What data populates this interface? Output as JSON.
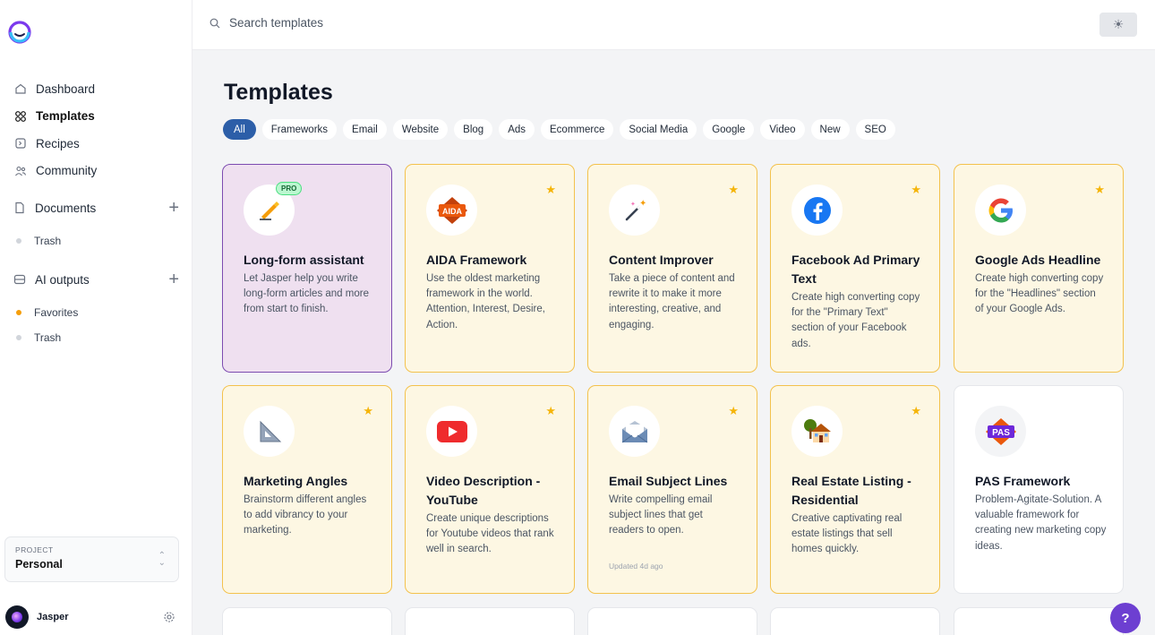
{
  "app": {
    "name": "Jasper"
  },
  "search": {
    "placeholder": "Search templates"
  },
  "sidebar": {
    "nav": [
      {
        "label": "Dashboard",
        "icon": "home-icon"
      },
      {
        "label": "Templates",
        "icon": "grid-icon",
        "active": true
      },
      {
        "label": "Recipes",
        "icon": "recipe-icon"
      },
      {
        "label": "Community",
        "icon": "community-icon"
      }
    ],
    "documents": {
      "label": "Documents",
      "trash": "Trash"
    },
    "ai_outputs": {
      "label": "AI outputs",
      "favorites": "Favorites",
      "trash": "Trash"
    },
    "project": {
      "label": "PROJECT",
      "value": "Personal"
    },
    "user": {
      "name": "Jasper"
    }
  },
  "main": {
    "title": "Templates",
    "chips": [
      "All",
      "Frameworks",
      "Email",
      "Website",
      "Blog",
      "Ads",
      "Ecommerce",
      "Social Media",
      "Google",
      "Video",
      "New",
      "SEO"
    ],
    "cards": [
      {
        "title": "Long-form assistant",
        "desc": "Let Jasper help you write long-form articles and more from start to finish.",
        "icon": "writing-hand-icon",
        "badge": "PRO",
        "style": "purple"
      },
      {
        "title": "AIDA Framework",
        "desc": "Use the oldest marketing framework in the world. Attention, Interest, Desire, Action.",
        "icon": "aida-icon",
        "icon_text": "AIDA",
        "star": true
      },
      {
        "title": "Content Improver",
        "desc": "Take a piece of content and rewrite it to make it more interesting, creative, and engaging.",
        "icon": "magic-wand-icon",
        "star": true
      },
      {
        "title": "Facebook Ad Primary Text",
        "desc": "Create high converting copy for the \"Primary Text\" section of your Facebook ads.",
        "icon": "facebook-icon",
        "star": true
      },
      {
        "title": "Google Ads Headline",
        "desc": "Create high converting copy for the \"Headlines\" section of your Google Ads.",
        "icon": "google-icon",
        "star": true
      },
      {
        "title": "Marketing Angles",
        "desc": "Brainstorm different angles to add vibrancy to your marketing.",
        "icon": "triangle-ruler-icon",
        "star": true
      },
      {
        "title": "Video Description - YouTube",
        "desc": "Create unique descriptions for Youtube videos that rank well in search.",
        "icon": "youtube-icon",
        "star": true
      },
      {
        "title": "Email Subject Lines",
        "desc": "Write compelling email subject lines that get readers to open.",
        "icon": "envelope-icon",
        "star": true,
        "updated": "Updated 4d ago"
      },
      {
        "title": "Real Estate Listing - Residential",
        "desc": "Creative captivating real estate listings that sell homes quickly.",
        "icon": "house-icon",
        "star": true
      },
      {
        "title": "PAS Framework",
        "desc": "Problem-Agitate-Solution. A valuable framework for creating new marketing copy ideas.",
        "icon": "pas-icon",
        "icon_text": "PAS",
        "style": "white"
      }
    ]
  },
  "colors": {
    "accent": "#2c5ea8",
    "card_border": "#f3c24d",
    "card_bg": "#fdf7e3",
    "pro_border": "#7c4bb0",
    "help": "#6d3fd1"
  },
  "help": {
    "label": "?"
  }
}
